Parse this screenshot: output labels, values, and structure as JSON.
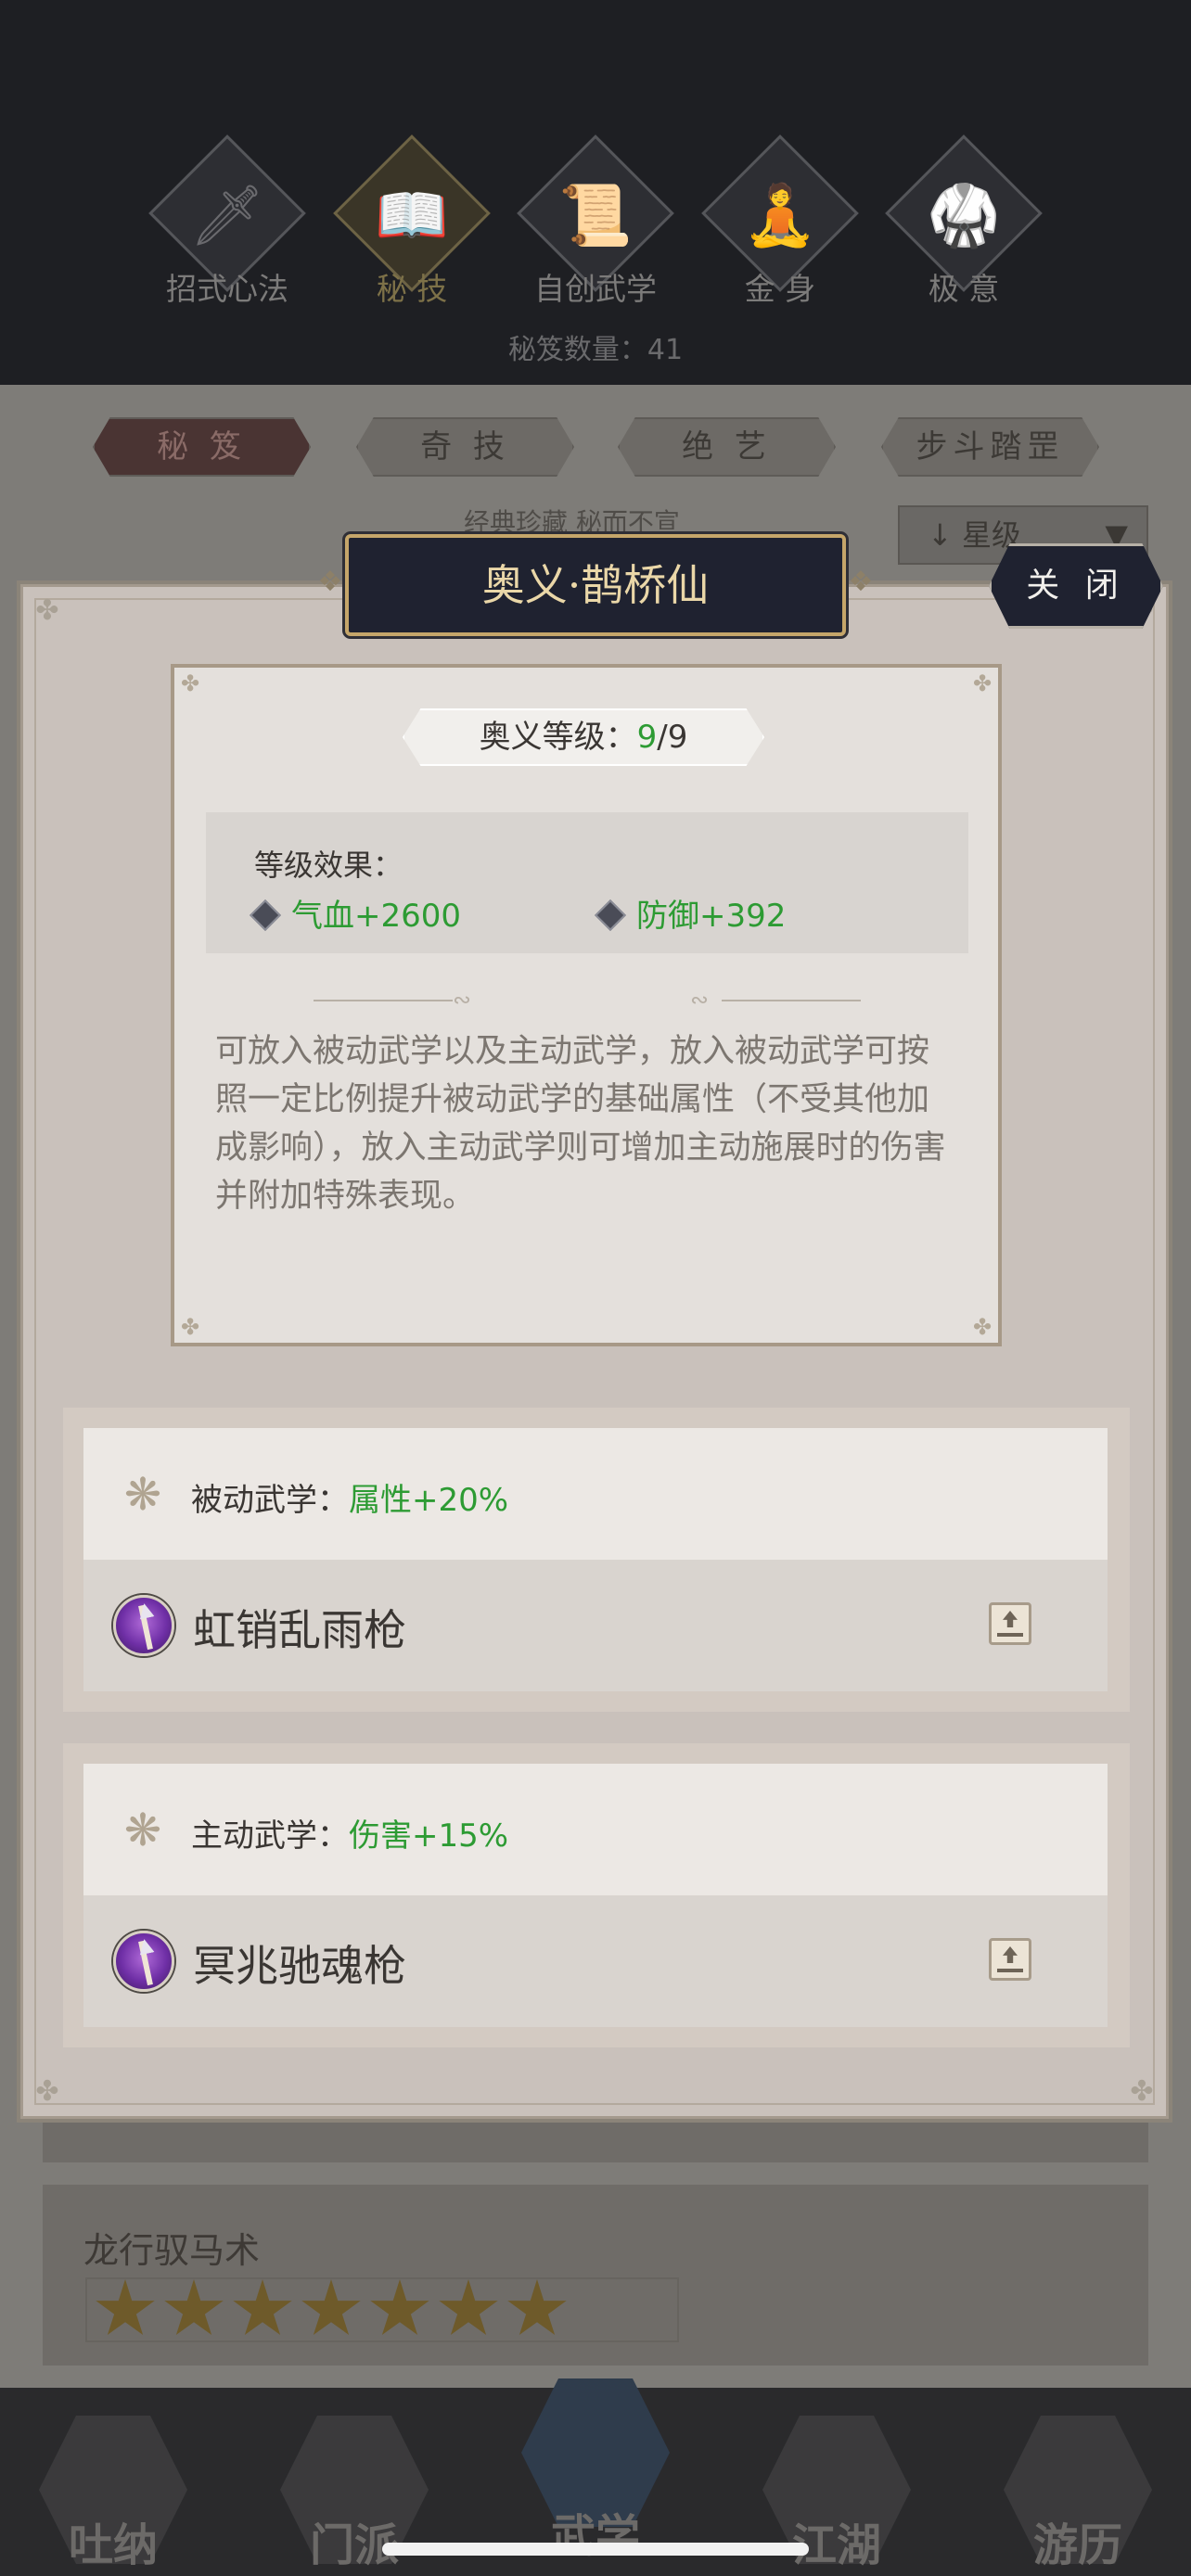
{
  "header": {
    "categories": [
      {
        "label": "招式心法",
        "icon": "sword-icon",
        "glyph": "🗡"
      },
      {
        "label": "秘 技",
        "icon": "book-icon",
        "glyph": "📖",
        "active": true
      },
      {
        "label": "自创武学",
        "icon": "scroll-icon",
        "glyph": "📜"
      },
      {
        "label": "金 身",
        "icon": "meditation-icon",
        "glyph": "🧘"
      },
      {
        "label": "极 意",
        "icon": "martial-pose-icon",
        "glyph": "🥋"
      }
    ],
    "scroll_count": "秘笈数量：41"
  },
  "background": {
    "tabs": [
      {
        "label": "秘 笈",
        "active": true
      },
      {
        "label": "奇 技"
      },
      {
        "label": "绝 艺"
      },
      {
        "label": "步斗踏罡"
      }
    ],
    "subtitle": "经典珍藏  秘而不宣",
    "sort_label": "星级",
    "card_name": "龙行驭马术",
    "card_stars": 7
  },
  "modal": {
    "title": "奥义·鹊桥仙",
    "close_label": "关 闭",
    "level_label": "奥义等级：",
    "level_current": "9",
    "level_max": "/9",
    "effect_title": "等级效果：",
    "effects": [
      {
        "text": "气血+2600"
      },
      {
        "text": "防御+392"
      }
    ],
    "description": "可放入被动武学以及主动武学，放入被动武学可按照一定比例提升被动武学的基础属性（不受其他加成影响），放入主动武学则可增加主动施展时的伤害并附加特殊表现。",
    "slots": [
      {
        "label": "被动武学：",
        "value": "属性+20%",
        "skill": "虹销乱雨枪"
      },
      {
        "label": "主动武学：",
        "value": "伤害+15%",
        "skill": "冥兆驰魂枪"
      }
    ]
  },
  "bottom_nav": [
    {
      "label": "吐纳",
      "icon": "monk-icon"
    },
    {
      "label": "门派",
      "icon": "banner-icon"
    },
    {
      "label": "武学",
      "icon": "books-icon",
      "active": true
    },
    {
      "label": "江湖",
      "icon": "straw-hat-icon"
    },
    {
      "label": "游历",
      "icon": "horse-icon"
    }
  ]
}
